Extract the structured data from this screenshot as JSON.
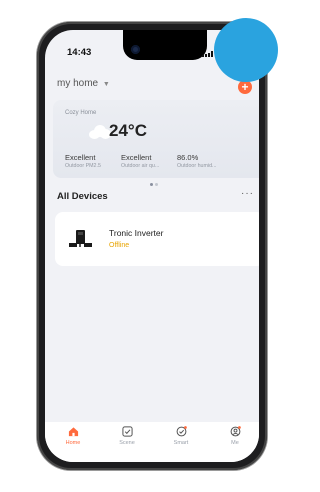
{
  "status": {
    "time": "14:43"
  },
  "header": {
    "home_name": "my home",
    "add_symbol": "+"
  },
  "weather": {
    "label": "Cozy Home",
    "temperature": "24°C",
    "metrics": [
      {
        "value": "Excellent",
        "label": "Outdoor PM2.5"
      },
      {
        "value": "Excellent",
        "label": "Outdoor air qu..."
      },
      {
        "value": "86.0%",
        "label": "Outdoor humid..."
      }
    ]
  },
  "devices": {
    "section_title": "All Devices",
    "more": "···",
    "items": [
      {
        "name": "Tronic Inverter",
        "status": "Offline"
      }
    ]
  },
  "tabs": [
    {
      "label": "Home",
      "icon": "home-icon",
      "active": true
    },
    {
      "label": "Scene",
      "icon": "scene-icon",
      "active": false
    },
    {
      "label": "Smart",
      "icon": "smart-icon",
      "active": false
    },
    {
      "label": "Me",
      "icon": "me-icon",
      "active": false
    }
  ],
  "colors": {
    "accent": "#ff6a3d",
    "offline": "#e8a400",
    "overlay": "#2aa3df"
  }
}
